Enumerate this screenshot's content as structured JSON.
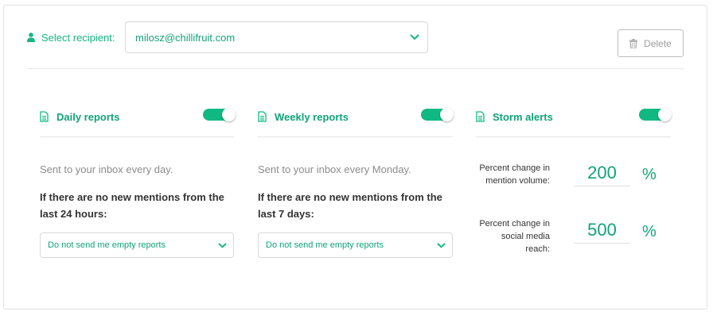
{
  "recipient": {
    "label": "Select recipient:",
    "value": "milosz@chillifruit.com",
    "icon": "user-icon"
  },
  "delete_button": {
    "label": "Delete",
    "icon": "trash-icon"
  },
  "columns": {
    "daily": {
      "title": "Daily reports",
      "enabled": true,
      "description": "Sent to your inbox every day.",
      "rule": "If there are no new mentions from the last 24 hours:",
      "select_value": "Do not send me empty reports"
    },
    "weekly": {
      "title": "Weekly reports",
      "enabled": true,
      "description": "Sent to your inbox every Monday.",
      "rule": "If there are no new mentions from the last 7 days:",
      "select_value": "Do not send me empty reports"
    },
    "storm": {
      "title": "Storm alerts",
      "enabled": true,
      "fields": [
        {
          "label": "Percent change in mention volume:",
          "value": "200",
          "unit": "%"
        },
        {
          "label": "Percent change in social media reach:",
          "value": "500",
          "unit": "%"
        }
      ]
    }
  },
  "colors": {
    "accent": "#10b981",
    "accent_text": "#10a37a",
    "muted_text": "#8c8c8c",
    "border": "#d9d9d9"
  }
}
